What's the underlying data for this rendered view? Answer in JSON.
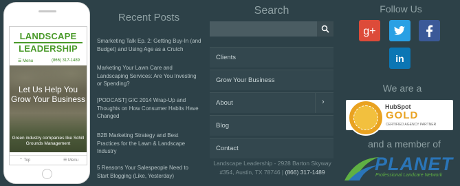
{
  "phone": {
    "logo_line1": "LANDSCAPE",
    "logo_line2": "LEADERSHIP",
    "menu_label": "☰ Menu",
    "phone_number": "(866) 317-1489",
    "hero_heading": "Let Us Help You Grow Your Business",
    "hero_subtext": "Green industry companies like Schill Grounds Management",
    "top_label": "⌃ Top",
    "bottom_menu_label": "☰ Menu"
  },
  "recent_posts": {
    "title": "Recent Posts",
    "items": [
      "Smarketing Talk Ep. 2: Getting Buy-In (and Budget) and Using Age as a Crutch",
      "Marketing Your Lawn Care and Landscaping Services: Are You Investing or Spending?",
      "[PODCAST] GIC 2014 Wrap-Up and Thoughts on How Consumer Habits Have Changed",
      "B2B Marketing Strategy and Best Practices for the Lawn & Landscape Industry",
      "5 Reasons Your Salespeople Need to Start Blogging (Like, Yesterday)"
    ]
  },
  "search": {
    "title": "Search",
    "placeholder": "",
    "value": ""
  },
  "nav": {
    "items": [
      "Clients",
      "Grow Your Business",
      "About",
      "Blog",
      "Contact"
    ],
    "about_arrow": "›"
  },
  "address": {
    "line1": "Landscape Leadership - 2928 Barton Skyway",
    "line2": "#354, Austin, TX 78746 | ",
    "phone": "(866) 317-1489"
  },
  "social": {
    "title": "Follow Us",
    "items": [
      {
        "name": "google-plus",
        "glyph": "g+",
        "color": "#dd4b39"
      },
      {
        "name": "twitter",
        "glyph": "t",
        "color": "#2aa0e4"
      },
      {
        "name": "facebook",
        "glyph": "f",
        "color": "#3b5998"
      },
      {
        "name": "linkedin",
        "glyph": "in",
        "color": "#0b76b4"
      }
    ]
  },
  "partner": {
    "title": "We are a",
    "hubspot": "HubSpot",
    "gold": "GOLD",
    "certified": "CERTIFIED AGENCY PARTNER"
  },
  "member": {
    "title": "and a member of",
    "planet": "PLANET",
    "planet_sub": "Professional Landcare Network"
  },
  "colors": {
    "background": "#2d4148",
    "heading": "#8fa1a4",
    "text": "#b4c2c4",
    "brand_green": "#4a9a2a",
    "hubspot_gold": "#e9a221",
    "planet_blue": "#2a75b8"
  }
}
